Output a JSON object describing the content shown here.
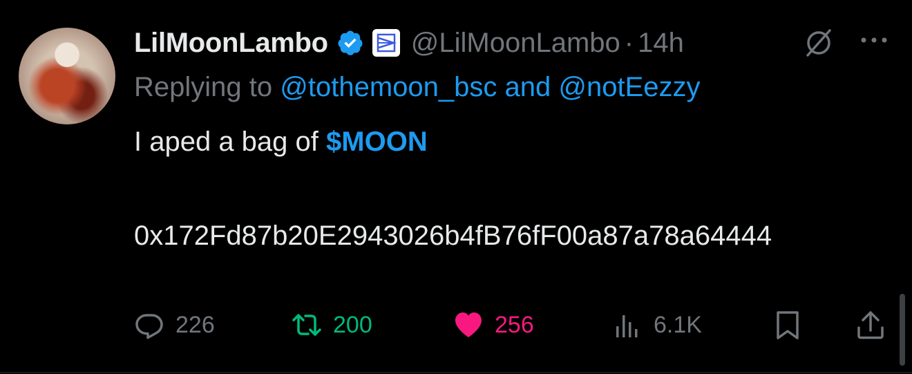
{
  "author": {
    "display_name": "LilMoonLambo",
    "handle": "@LilMoonLambo",
    "separator": "·",
    "time": "14h"
  },
  "reply_context": {
    "prefix": "Replying to",
    "mention1": "@tothemoon_bsc",
    "joiner": "and",
    "mention2": "@notEezzy"
  },
  "content": {
    "text_before_cashtag": "I aped a bag of",
    "cashtag": "$MOON",
    "address": "0x172Fd87b20E2943026b4fB76fF00a87a78a64444"
  },
  "actions": {
    "replies": "226",
    "reposts": "200",
    "likes": "256",
    "views": "6.1K"
  },
  "colors": {
    "accent": "#1d9bf0",
    "repost": "#00ba7c",
    "like": "#f91880",
    "muted": "#71767b",
    "text": "#e7e9ea",
    "background": "#000000"
  },
  "icons": {
    "verified": "verified-badge-icon",
    "affiliate": "affiliate-logo-icon",
    "grok": "grok-icon",
    "more": "more-icon",
    "reply": "reply-icon",
    "repost": "repost-icon",
    "like": "heart-icon",
    "views": "views-icon",
    "bookmark": "bookmark-icon",
    "share": "share-icon"
  }
}
